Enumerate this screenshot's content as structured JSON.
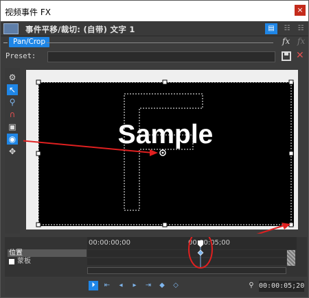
{
  "window": {
    "title": "视频事件 FX",
    "close": "×"
  },
  "header": {
    "title": "事件平移/裁切: (自带) 文字 1"
  },
  "plugin": {
    "chip_label": "Pan/Crop",
    "fx_label": "fx"
  },
  "preset": {
    "label": "Preset:",
    "value": ""
  },
  "preview": {
    "sample_text": "Sample"
  },
  "timeline": {
    "time_start": "00:00:00;00",
    "time_mid": "00:00:05;00",
    "tracks": [
      "位置",
      "蒙板"
    ],
    "timecode": "00:00:05;20"
  },
  "tools": [
    "gear-icon",
    "pointer-icon",
    "zoom-icon",
    "magnet-icon",
    "crop-icon",
    "center-icon",
    "move-icon"
  ],
  "colors": {
    "accent": "#1f86e6",
    "annotation": "#e02020"
  }
}
